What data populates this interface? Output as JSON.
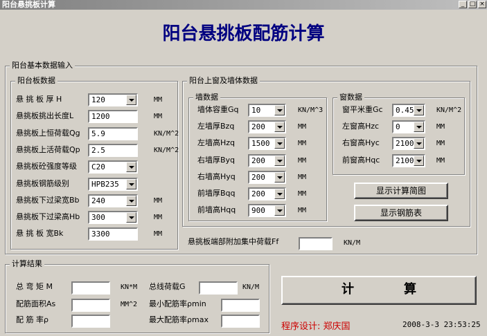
{
  "window": {
    "title": "阳台悬挑板计算",
    "min": "_",
    "max": "□",
    "close": "×"
  },
  "main_title": "阳台悬挑板配筋计算",
  "basic": {
    "label": "阳台基本数据输入",
    "slab": {
      "label": "阳台板数据",
      "rows": [
        {
          "label": "悬 挑 板 厚 H",
          "value": "120",
          "unit": "MM"
        },
        {
          "label": "悬挑板挑出长度L",
          "value": "1200",
          "unit": "MM"
        },
        {
          "label": "悬挑板上恒荷载Qg",
          "value": "5.9",
          "unit": "KN/M^2"
        },
        {
          "label": "悬挑板上活荷载Qp",
          "value": "2.5",
          "unit": "KN/M^2"
        },
        {
          "label": "悬挑板砼强度等级",
          "value": "C20",
          "unit": ""
        },
        {
          "label": "悬挑板钢筋级别",
          "value": "HPB235",
          "unit": ""
        },
        {
          "label": "悬挑板下过梁宽Bb",
          "value": "240",
          "unit": "MM"
        },
        {
          "label": "悬挑板下过梁高Hb",
          "value": "300",
          "unit": "MM"
        },
        {
          "label": "悬 挑 板 宽Bk",
          "value": "3300",
          "unit": "MM"
        }
      ]
    },
    "upper": {
      "label": "阳台上窗及墙体数据",
      "wall": {
        "label": "墙数据",
        "rows": [
          {
            "label": "墙体容重Gq",
            "value": "10",
            "unit": "KN/M^3"
          },
          {
            "label": "左墙厚Bzq",
            "value": "200",
            "unit": "MM"
          },
          {
            "label": "左墙高Hzq",
            "value": "1500",
            "unit": "MM"
          },
          {
            "label": "右墙厚Byq",
            "value": "200",
            "unit": "MM"
          },
          {
            "label": "右墙高Hyq",
            "value": "200",
            "unit": "MM"
          },
          {
            "label": "前墙厚Bqq",
            "value": "200",
            "unit": "MM"
          },
          {
            "label": "前墙高Hqq",
            "value": "900",
            "unit": "MM"
          }
        ]
      },
      "window": {
        "label": "窗数据",
        "rows": [
          {
            "label": "窗平米重Gc",
            "value": "0.45",
            "unit": "KN/M^2"
          },
          {
            "label": "左窗高Hzc",
            "value": "0",
            "unit": "MM"
          },
          {
            "label": "右窗高Hyc",
            "value": "2100",
            "unit": "MM"
          },
          {
            "label": "前窗高Hqc",
            "value": "2100",
            "unit": "MM"
          }
        ]
      },
      "show_diagram": "显示计算简图",
      "show_rebar": "显示钢筋表"
    },
    "concentrated": {
      "label": "悬挑板端部附加集中荷载Ff",
      "value": "",
      "unit": "KN/M"
    }
  },
  "results": {
    "label": "计算结果",
    "moment": {
      "label": "总 弯 矩 M",
      "value": "",
      "unit": "KN*M"
    },
    "total_load": {
      "label": "总线荷载G",
      "value": "",
      "unit": "KN/M"
    },
    "area": {
      "label": "配筋面积As",
      "value": "",
      "unit": "MM^2"
    },
    "min_ratio": {
      "label": "最小配筋率ρmin",
      "value": ""
    },
    "ratio": {
      "label": "配 筋 率ρ",
      "value": ""
    },
    "max_ratio": {
      "label": "最大配筋率ρmax",
      "value": ""
    }
  },
  "calc_button": "计　　　　算",
  "credit": "程序设计: 郑庆国",
  "timestamp": "2008-3-3  23:53:25"
}
